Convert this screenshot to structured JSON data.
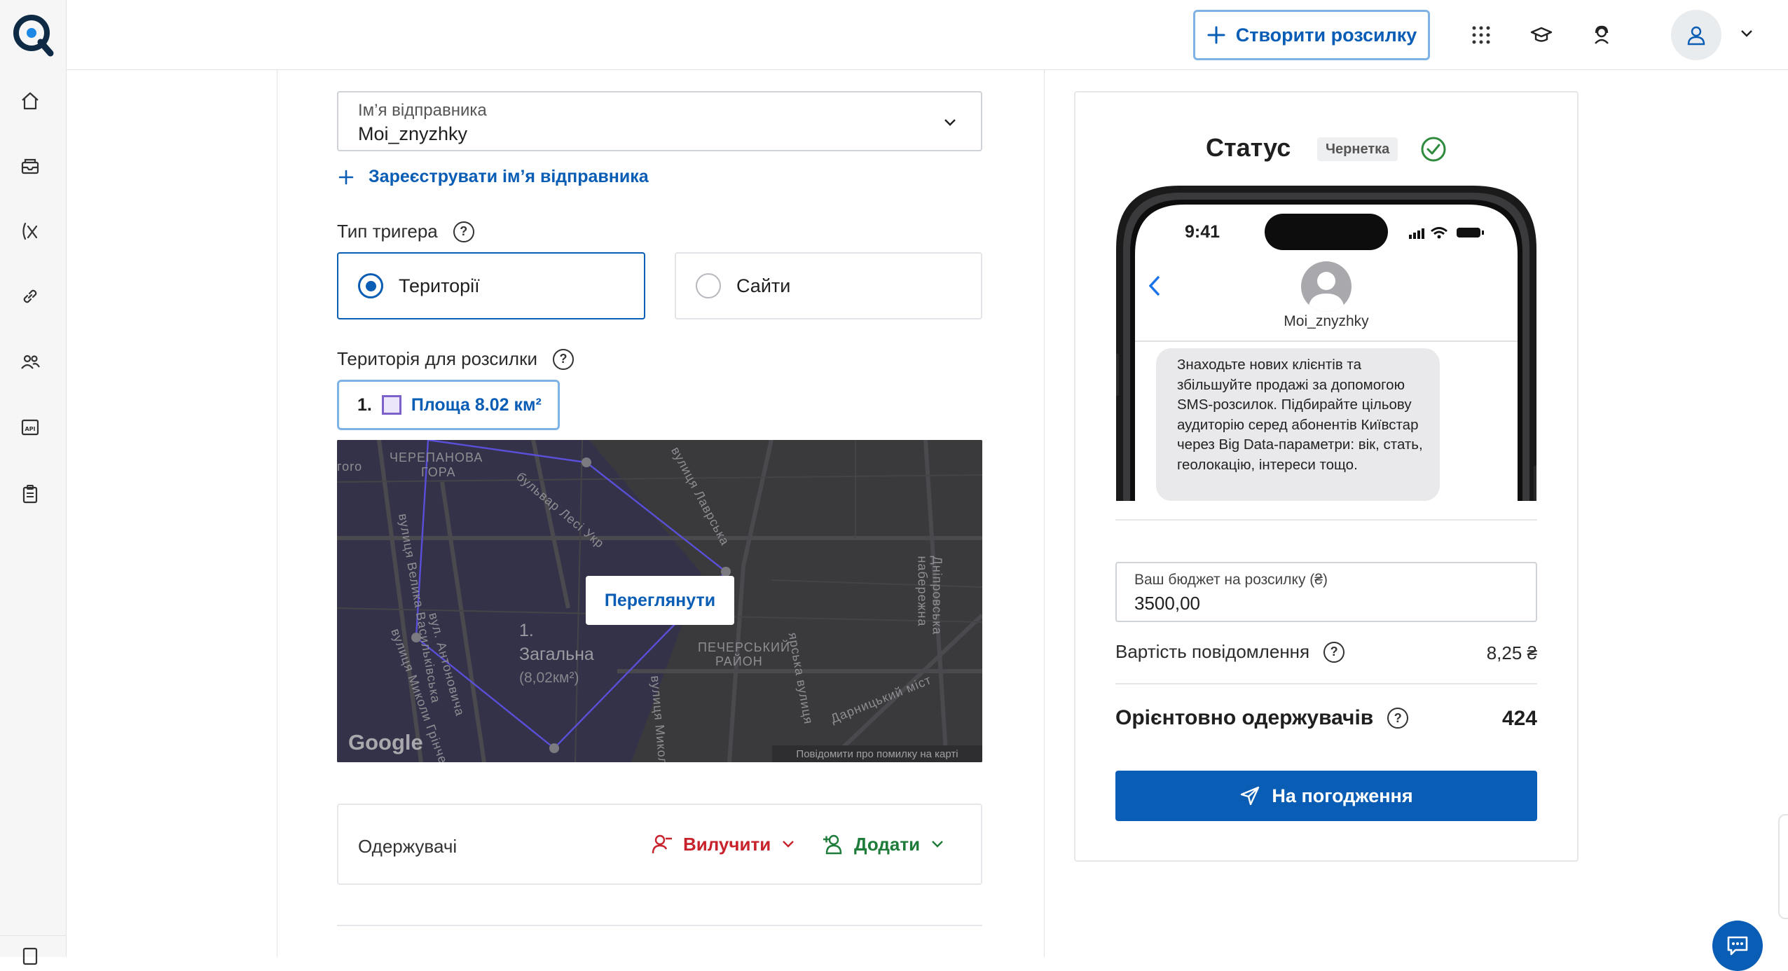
{
  "header": {
    "create_button_label": "Створити розсилку"
  },
  "form": {
    "sender_label": "Ім’я відправника",
    "sender_value": "Moi_znyzhky",
    "register_link": "Зареєструвати ім’я відправника",
    "trigger_type_label": "Тип тригера",
    "trigger_options": [
      {
        "label": "Території",
        "selected": true
      },
      {
        "label": "Сайти",
        "selected": false
      }
    ],
    "territory_label": "Територія для розсилки",
    "territory_tag_index": "1.",
    "territory_tag_label": "Площа 8.02 км²",
    "map": {
      "view_button": "Переглянути",
      "area_number": "1.",
      "area_name": "Загальна",
      "area_size": "(8,02км²)",
      "labels": [
        "ЧЕРЕПАНОВА",
        "ГОРА",
        "бульвар Лесі Укр",
        "вулиця Лаврська",
        "вулиця Велика Васильківська",
        "вул. Антоновича",
        "вулиця Миколи Грінченка",
        "ПЕЧЕРСЬКИЙ",
        "РАЙОН",
        "Дарницький міст",
        "Дніпровська набережна",
        "вулиця Микол",
        "ярська вулиця",
        "гоrо"
      ],
      "google": "Google",
      "report": "Повідомити про помилку на карті"
    },
    "recipients_label": "Одержувачі",
    "exclude_label": "Вилучити",
    "add_label": "Додати"
  },
  "panel": {
    "status_title": "Статус",
    "status_badge": "Чернетка",
    "phone": {
      "time": "9:41",
      "contact": "Moi_znyzhky",
      "message": "Знаходьте нових клієнтів та збільшуйте продажі за допомогою SMS-розсилок. Підбирайте цільову аудиторію серед абонентів Київстар через Big Data-параметри: вік, стать, геолокацію, інтереси тощо."
    },
    "budget_label": "Ваш бюджет на розсилку (₴)",
    "budget_value": "3500,00",
    "cost_label": "Вартість повідомлення",
    "cost_value": "8,25 ₴",
    "recipients_label": "Орієнтовно одержувачів",
    "recipients_value": "424",
    "submit_label": "На погодження"
  },
  "colors": {
    "accent": "#0a5db5",
    "exclude": "#c8232c",
    "add": "#1e7b3a",
    "success": "#2e8b3e"
  }
}
